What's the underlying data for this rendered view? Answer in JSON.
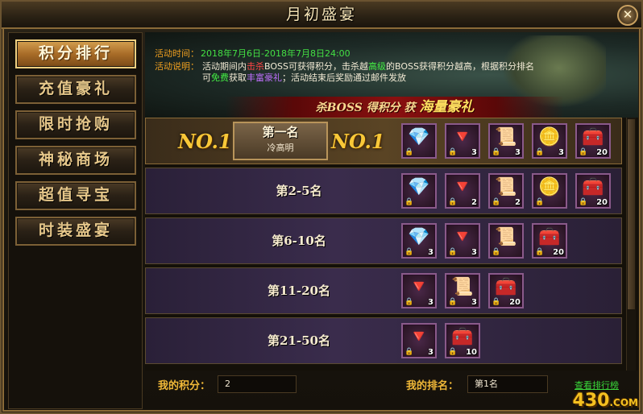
{
  "window": {
    "title": "月初盛宴",
    "close_label": "✕"
  },
  "sidebar": {
    "items": [
      {
        "label": "积分排行",
        "active": true
      },
      {
        "label": "充值豪礼",
        "active": false
      },
      {
        "label": "限时抢购",
        "active": false
      },
      {
        "label": "神秘商场",
        "active": false
      },
      {
        "label": "超值寻宝",
        "active": false
      },
      {
        "label": "时装盛宴",
        "active": false
      }
    ]
  },
  "info": {
    "time_label": "活动时间：",
    "time_value": "2018年7月6日-2018年7月8日24:00",
    "desc_label": "活动说明：",
    "desc_parts": [
      "活动期间内",
      "击杀",
      "BOSS可获得积分，击杀越",
      "高级",
      "的BOSS获得积分越高，根据积分排名可",
      "免费",
      "获取",
      "丰富豪礼",
      "；活动结束后奖励通过邮件发放"
    ]
  },
  "slogan": {
    "prefix": "杀BOSS 得积分 获",
    "highlight": "海量豪礼"
  },
  "ranks": [
    {
      "label": "第一名",
      "player": "冷高明",
      "badge": "NO.1",
      "items": [
        {
          "icon": "diamond-icon",
          "glyph": "💎",
          "count": ""
        },
        {
          "icon": "crystal-icon",
          "glyph": "🔻",
          "count": "3"
        },
        {
          "icon": "scroll-icon",
          "glyph": "📜",
          "count": "3"
        },
        {
          "icon": "coin-icon",
          "glyph": "🪙",
          "count": "3"
        },
        {
          "icon": "treasure-chest-icon",
          "glyph": "🧰",
          "count": "20"
        }
      ]
    },
    {
      "label": "第2-5名",
      "items": [
        {
          "icon": "diamond-icon",
          "glyph": "💎",
          "count": ""
        },
        {
          "icon": "crystal-icon",
          "glyph": "🔻",
          "count": "2"
        },
        {
          "icon": "scroll-icon",
          "glyph": "📜",
          "count": "2"
        },
        {
          "icon": "coin-icon",
          "glyph": "🪙",
          "count": ""
        },
        {
          "icon": "treasure-chest-icon",
          "glyph": "🧰",
          "count": "20"
        }
      ]
    },
    {
      "label": "第6-10名",
      "items": [
        {
          "icon": "diamond-icon",
          "glyph": "💎",
          "count": "3"
        },
        {
          "icon": "crystal-icon",
          "glyph": "🔻",
          "count": "3"
        },
        {
          "icon": "scroll-icon",
          "glyph": "📜",
          "count": ""
        },
        {
          "icon": "treasure-chest-icon",
          "glyph": "🧰",
          "count": "20"
        }
      ]
    },
    {
      "label": "第11-20名",
      "items": [
        {
          "icon": "crystal-icon",
          "glyph": "🔻",
          "count": "3"
        },
        {
          "icon": "scroll-icon",
          "glyph": "📜",
          "count": "3"
        },
        {
          "icon": "treasure-chest-icon",
          "glyph": "🧰",
          "count": "20"
        }
      ]
    },
    {
      "label": "第21-50名",
      "items": [
        {
          "icon": "crystal-icon",
          "glyph": "🔻",
          "count": "3"
        },
        {
          "icon": "treasure-chest-icon",
          "glyph": "🧰",
          "count": "10"
        }
      ]
    }
  ],
  "footer": {
    "my_score_label": "我的积分：",
    "my_score_value": "2",
    "my_rank_label": "我的排名：",
    "my_rank_value": "第1名",
    "view_ranking_link": "查看排行榜"
  },
  "watermark": {
    "text": "430",
    "suffix": ".COM"
  },
  "colors": {
    "accent_gold": "#f0b838",
    "link_green": "#3ad63a",
    "highlight_red": "#ff4444"
  }
}
